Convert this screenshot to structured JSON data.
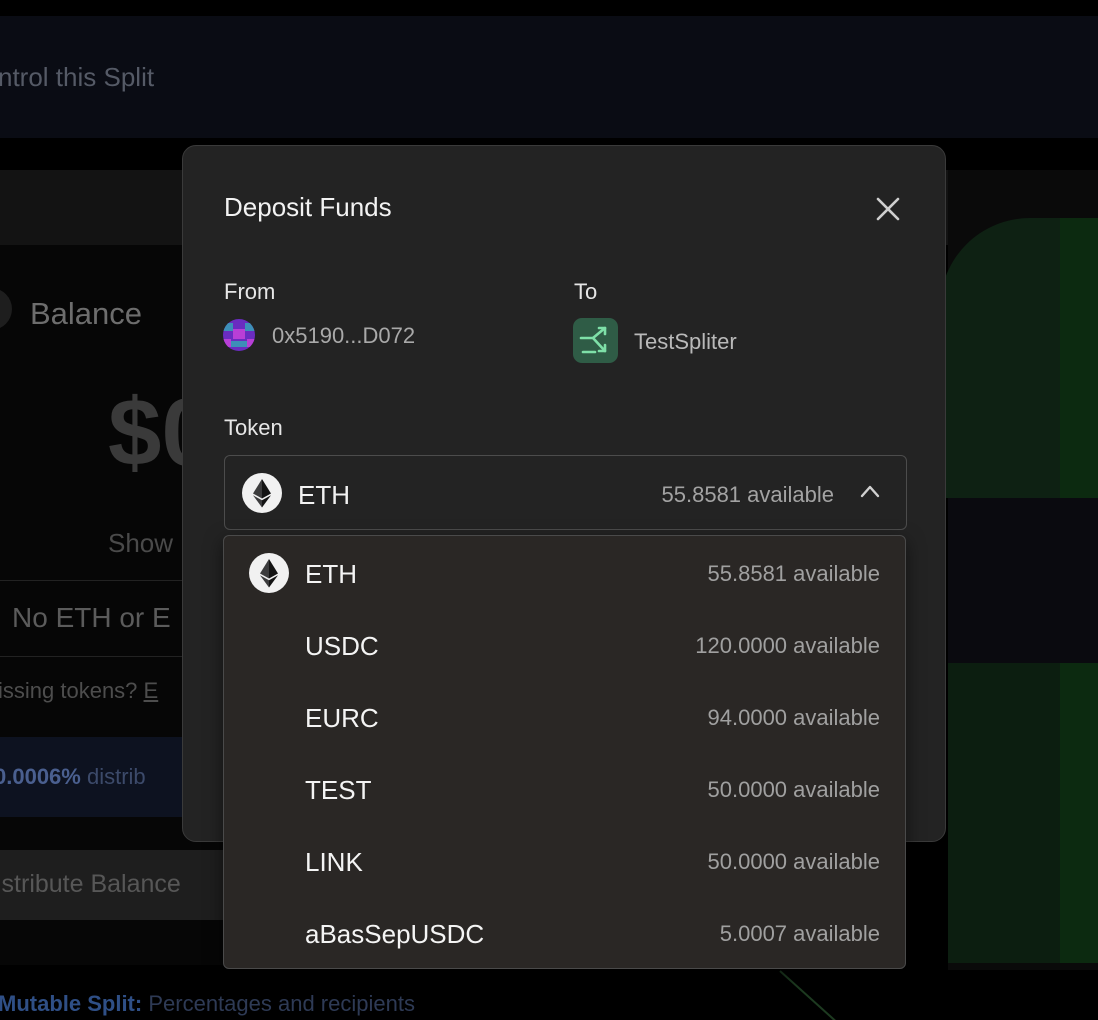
{
  "background": {
    "banner_text": "ntrol this Split",
    "balance_title": "Balance",
    "balance_value": "$0",
    "show_label": "Show",
    "no_tokens_text": "No ETH or E",
    "missing_text": "issing tokens?",
    "missing_link": "E",
    "dist_pct": "0.0006%",
    "dist_text": "distrib",
    "distribute_button": "istribute Balance",
    "mutable_label": "Mutable Split:",
    "mutable_text": "Percentages and recipients"
  },
  "modal": {
    "title": "Deposit Funds",
    "close_icon": "close-icon",
    "from_label": "From",
    "from_address": "0x5190...D072",
    "to_label": "To",
    "to_name": "TestSpliter",
    "token_label": "Token",
    "selected_token": {
      "symbol": "ETH",
      "available": "55.8581 available",
      "icon": "ethereum-icon"
    }
  },
  "dropdown": {
    "options": [
      {
        "symbol": "ETH",
        "available": "55.8581 available",
        "has_icon": true
      },
      {
        "symbol": "USDC",
        "available": "120.0000 available",
        "has_icon": false
      },
      {
        "symbol": "EURC",
        "available": "94.0000 available",
        "has_icon": false
      },
      {
        "symbol": "TEST",
        "available": "50.0000 available",
        "has_icon": false
      },
      {
        "symbol": "LINK",
        "available": "50.0000 available",
        "has_icon": false
      },
      {
        "symbol": "aBasSepUSDC",
        "available": "5.0007 available",
        "has_icon": false
      }
    ]
  },
  "colors": {
    "modal_bg": "#232323",
    "dropdown_bg": "#2a2725",
    "split_icon_bg": "#2f5c46",
    "split_icon_fg": "#7ee0a8"
  }
}
